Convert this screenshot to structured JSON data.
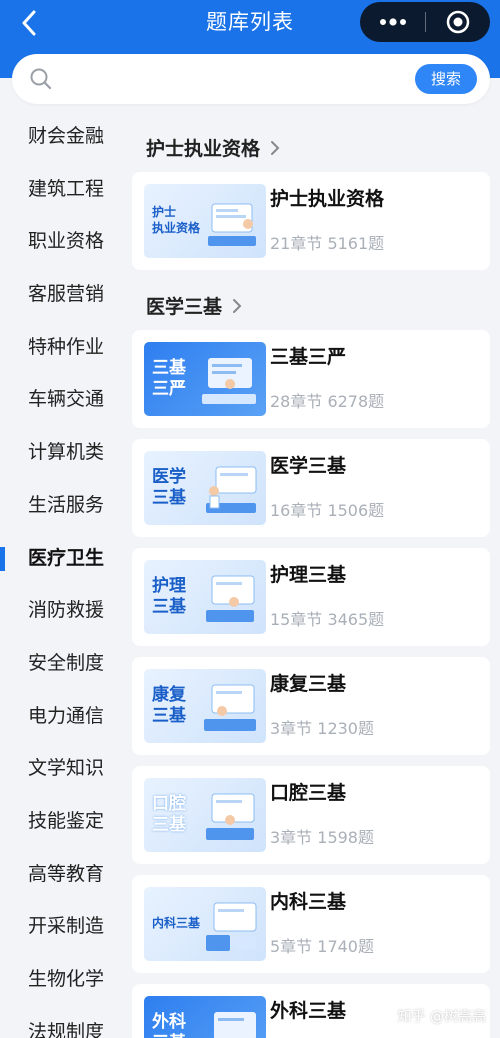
{
  "header": {
    "title": "题库列表"
  },
  "search": {
    "placeholder": "",
    "button_label": "搜索"
  },
  "sidebar": {
    "items": [
      {
        "label": "财会金融"
      },
      {
        "label": "建筑工程"
      },
      {
        "label": "职业资格"
      },
      {
        "label": "客服营销"
      },
      {
        "label": "特种作业"
      },
      {
        "label": "车辆交通"
      },
      {
        "label": "计算机类"
      },
      {
        "label": "生活服务"
      },
      {
        "label": "医疗卫生",
        "active": true
      },
      {
        "label": "消防救援"
      },
      {
        "label": "安全制度"
      },
      {
        "label": "电力通信"
      },
      {
        "label": "文学知识"
      },
      {
        "label": "技能鉴定"
      },
      {
        "label": "高等教育"
      },
      {
        "label": "开采制造"
      },
      {
        "label": "生物化学"
      },
      {
        "label": "法规制度"
      }
    ]
  },
  "sections": [
    {
      "title": "护士执业资格",
      "cards": [
        {
          "name": "护士执业资格",
          "meta": "21章节 5161题",
          "thumb_text": "护士\n执业资格"
        }
      ]
    },
    {
      "title": "医学三基",
      "cards": [
        {
          "name": "三基三严",
          "meta": "28章节 6278题",
          "thumb_text": "三基\n三严"
        },
        {
          "name": "医学三基",
          "meta": "16章节 1506题",
          "thumb_text": "医学\n三基"
        },
        {
          "name": "护理三基",
          "meta": "15章节 3465题",
          "thumb_text": "护理\n三基"
        },
        {
          "name": "康复三基",
          "meta": "3章节 1230题",
          "thumb_text": "康复\n三基"
        },
        {
          "name": "口腔三基",
          "meta": "3章节 1598题",
          "thumb_text": "口腔\n三基"
        },
        {
          "name": "内科三基",
          "meta": "5章节 1740题",
          "thumb_text": "内科三基"
        },
        {
          "name": "外科三基",
          "meta": "",
          "thumb_text": "外科\n三基"
        }
      ]
    }
  ],
  "watermark": "知乎 @树高高",
  "colors": {
    "primary": "#1a73e8",
    "button": "#2f86f6",
    "background": "#f2f4f7"
  },
  "icons": {
    "back": "chevron-left-icon",
    "more": "more-dots-icon",
    "close": "target-circle-icon",
    "search": "search-icon",
    "section_chevron": "chevron-right-icon"
  }
}
